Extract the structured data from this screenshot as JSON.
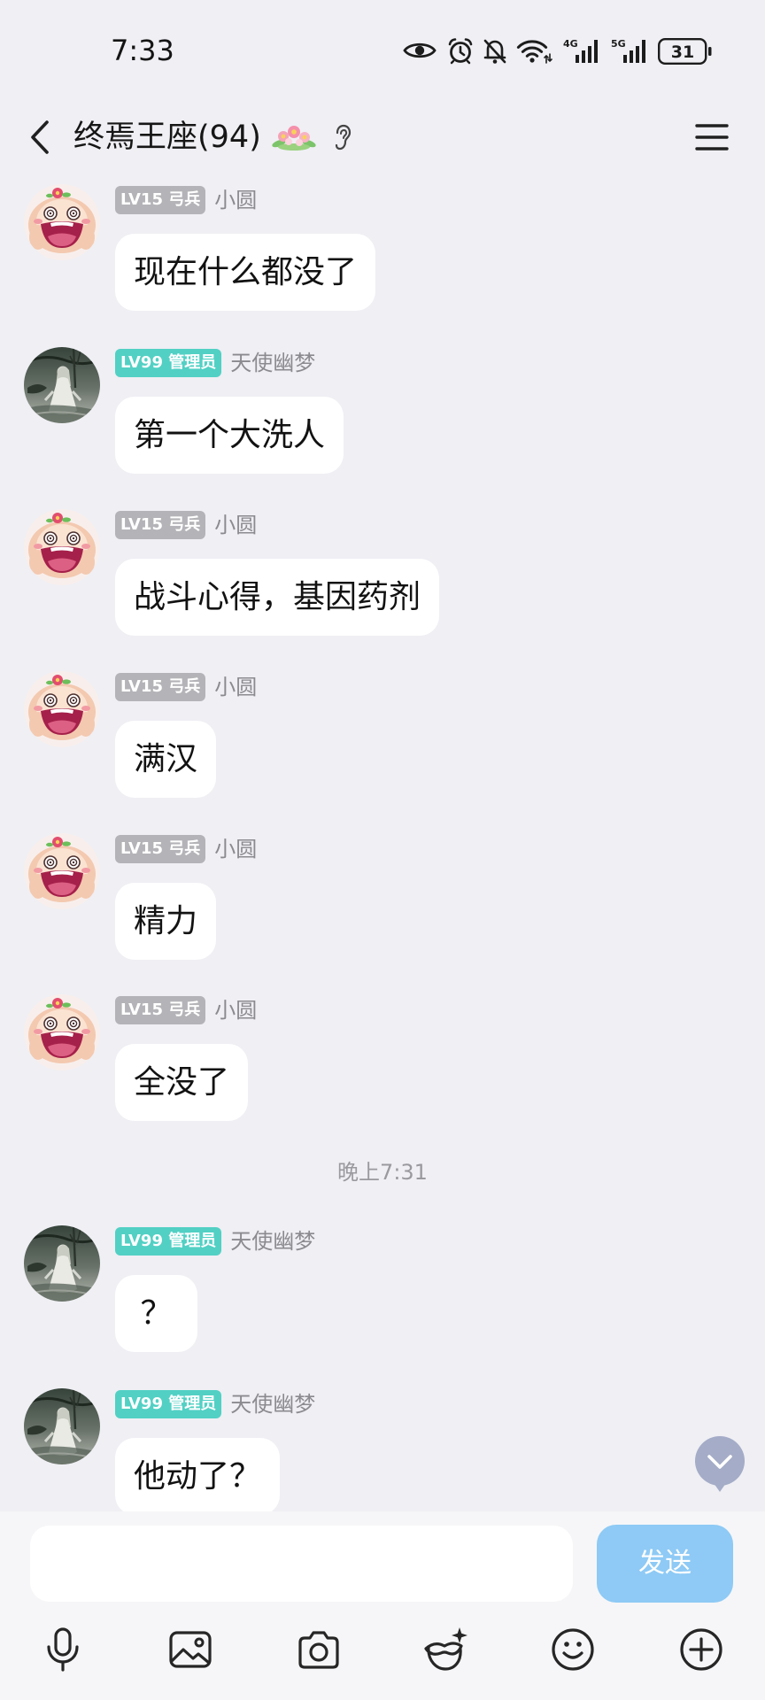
{
  "theme": {
    "background": "#efeff4",
    "bubble": "#ffffff",
    "badge_member": "#b4b4b8",
    "badge_admin": "#52d0c4",
    "send_button": "#8ecaf5",
    "scroll_button": "#a4acc7",
    "input_bar": "#f6f6f8"
  },
  "status_bar": {
    "time": "7:33",
    "icons": [
      "eye-icon",
      "alarm-icon",
      "bell-off-icon",
      "wifi-icon",
      "signal-4g-icon",
      "signal-5g-icon",
      "battery-icon"
    ],
    "signal_1_label": "4G",
    "signal_2_label": "5G",
    "battery_level": "31"
  },
  "header": {
    "title": "终焉王座(94)",
    "icons": [
      "back-arrow-icon",
      "flower-badge-icon",
      "ear-icon",
      "menu-icon"
    ]
  },
  "chat": {
    "messages": [
      {
        "avatar": "avatar-xiaoyuan",
        "badge": "LV15 弓兵",
        "sender": "小圆",
        "text": "现在什么都没了"
      },
      {
        "avatar": "avatar-tianshi",
        "badge": "LV99 管理员",
        "sender": "天使幽梦",
        "text": "第一个大洗人"
      },
      {
        "avatar": "avatar-xiaoyuan",
        "badge": "LV15 弓兵",
        "sender": "小圆",
        "text": "战斗心得，基因药剂"
      },
      {
        "avatar": "avatar-xiaoyuan",
        "badge": "LV15 弓兵",
        "sender": "小圆",
        "text": "满汉"
      },
      {
        "avatar": "avatar-xiaoyuan",
        "badge": "LV15 弓兵",
        "sender": "小圆",
        "text": "精力"
      },
      {
        "avatar": "avatar-xiaoyuan",
        "badge": "LV15 弓兵",
        "sender": "小圆",
        "text": "全没了"
      },
      {
        "avatar": "avatar-tianshi",
        "badge": "LV99 管理员",
        "sender": "天使幽梦",
        "text": "？"
      },
      {
        "avatar": "avatar-tianshi",
        "badge": "LV99 管理员",
        "sender": "天使幽梦",
        "text": "他动了？"
      }
    ],
    "time_divider": "晚上7:31"
  },
  "scroll_down": {
    "icon": "chevron-down-icon"
  },
  "input": {
    "value": "",
    "send_label": "发送"
  },
  "toolbar": {
    "items": [
      "mic-icon",
      "image-icon",
      "camera-icon",
      "mask-sparkle-icon",
      "smile-icon",
      "plus-circle-icon"
    ]
  }
}
